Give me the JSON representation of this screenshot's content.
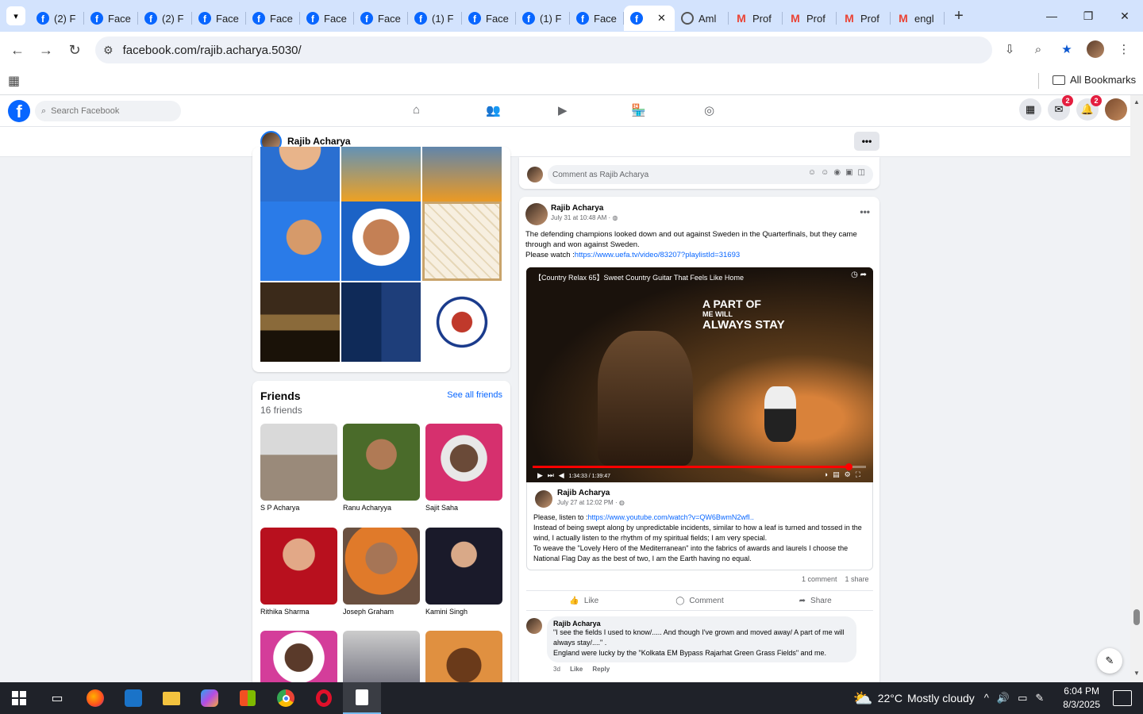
{
  "browser": {
    "tabs": [
      {
        "title": "(2) F",
        "icon": "facebook-icon"
      },
      {
        "title": "Face",
        "icon": "facebook-icon"
      },
      {
        "title": "(2) F",
        "icon": "facebook-icon"
      },
      {
        "title": "Face",
        "icon": "facebook-icon"
      },
      {
        "title": "Face",
        "icon": "facebook-icon"
      },
      {
        "title": "Face",
        "icon": "facebook-icon"
      },
      {
        "title": "Face",
        "icon": "facebook-icon"
      },
      {
        "title": "(1) F",
        "icon": "facebook-icon"
      },
      {
        "title": "Face",
        "icon": "facebook-icon"
      },
      {
        "title": "(1) F",
        "icon": "facebook-icon"
      },
      {
        "title": "Face",
        "icon": "facebook-icon"
      },
      {
        "title": "",
        "icon": "facebook-icon",
        "active": true
      },
      {
        "title": "Aml",
        "icon": "globe-icon"
      },
      {
        "title": "Prof",
        "icon": "gmail-icon"
      },
      {
        "title": "Prof",
        "icon": "gmail-icon"
      },
      {
        "title": "Prof",
        "icon": "gmail-icon"
      },
      {
        "title": "engl",
        "icon": "gmail-icon"
      }
    ],
    "url": "facebook.com/rajib.acharya.5030/",
    "bookmarks_label": "All Bookmarks"
  },
  "facebook": {
    "search_placeholder": "Search Facebook",
    "messenger_badge": "2",
    "notifications_badge": "2",
    "profile_name": "Rajib Acharya"
  },
  "friends": {
    "title": "Friends",
    "count": "16 friends",
    "see_all": "See all friends",
    "list": [
      {
        "name": "S P Acharya"
      },
      {
        "name": "Ranu Acharyya"
      },
      {
        "name": "Sajit Saha"
      },
      {
        "name": "Rithika Sharma"
      },
      {
        "name": "Joseph Graham"
      },
      {
        "name": "Kamini Singh"
      }
    ]
  },
  "comment_box": {
    "placeholder": "Comment as Rajib Acharya"
  },
  "post": {
    "author": "Rajib Acharya",
    "time": "July 31 at 10:48 AM",
    "text": "The defending champions looked down and out against Sweden in the Quarterfinals, but they came through and won against Sweden.",
    "watch_prefix": "Please watch :",
    "link": "https://www.uefa.tv/video/83207?playlistId=31693",
    "video": {
      "title": "【Country Relax 65】Sweet Country Guitar That Feels Like Home",
      "overlay_line1": "A PART OF",
      "overlay_line2": "ME WILL",
      "overlay_line3": "ALWAYS STAY",
      "time": "1:34:33 / 1:39:47",
      "progress": 0.947
    },
    "shared": {
      "author": "Rajib Acharya",
      "time": "July 27 at 12:02 PM",
      "listen_prefix": "Please, listen to :",
      "link": "https://www.youtube.com/watch?v=QW6BwmN2wfI..",
      "text1": "Instead of being swept along by unpredictable incidents, similar to how a leaf is turned and tossed in the wind, I actually listen to the rhythm of my spiritual fields; I am very special.",
      "text2": "To weave the \"Lovely Hero of the Mediterranean\" into the fabrics of awards and laurels I choose the National  Flag Day as the best of two, I am the Earth having no equal."
    },
    "comments_count": "1 comment",
    "shares_count": "1 share",
    "actions": {
      "like": "Like",
      "comment": "Comment",
      "share": "Share"
    },
    "comment": {
      "author": "Rajib Acharya",
      "line1": "\"I see the fields I used to know/..... And though I've grown and moved away/ A part of me will always stay/....\" .",
      "line2": "England were lucky by the \"Kolkata EM Bypass Rajarhat Green Grass Fields\" and me.",
      "age": "3d",
      "like": "Like",
      "reply": "Reply"
    }
  },
  "taskbar": {
    "weather_temp": "22°C",
    "weather_text": "Mostly cloudy",
    "time": "6:04 PM",
    "date": "8/3/2025"
  },
  "colors": {
    "facebook_blue": "#0866ff",
    "tab_strip": "#d3e3fd",
    "taskbar": "#1f2229"
  }
}
